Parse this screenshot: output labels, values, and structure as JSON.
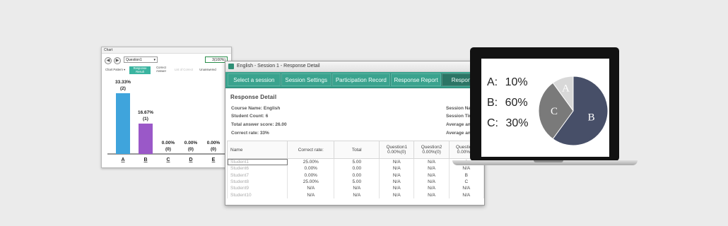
{
  "chart_window": {
    "title": "Chart",
    "nav_back": "◀",
    "nav_forward": "▶",
    "question_select": "Question1",
    "count_box": "3(100%)",
    "tabs": [
      {
        "label": "Chart Pattern ▾"
      },
      {
        "label": "Response Result",
        "active": true
      },
      {
        "label": "Correct Answer"
      },
      {
        "label": "List of Correct"
      },
      {
        "label": "Unanswered"
      }
    ]
  },
  "chart_data": {
    "type": "bar",
    "categories": [
      "A",
      "B",
      "C",
      "D",
      "E"
    ],
    "values": [
      33.33,
      16.67,
      0,
      0,
      0
    ],
    "value_labels": [
      "33.33%",
      "16.67%",
      "0.00%",
      "0.00%",
      "0.00%"
    ],
    "count_labels": [
      "(2)",
      "(1)",
      "(0)",
      "(0)",
      "(0)"
    ],
    "colors": [
      "#3fa4dc",
      "#9a58c8",
      "#999999",
      "#999999",
      "#999999"
    ],
    "ylim": [
      0,
      33.33
    ]
  },
  "detail_window": {
    "title": "English - Session 1 - Response Detail",
    "nav": [
      {
        "label": "Select a session"
      },
      {
        "label": "Session Settings"
      },
      {
        "label": "Participation Record"
      },
      {
        "label": "Response Report"
      },
      {
        "label": "Respons",
        "active": true
      }
    ],
    "heading": "Response Detail",
    "course": "Course Name: English",
    "student_count": "Student Count: 6",
    "total_score": "Total answer score: 26.00",
    "correct_rate": "Correct rate: 33%",
    "session_name": "Session Name",
    "session_time": "Session Time:",
    "avg_1": "Average answe",
    "avg_2": "Average answe",
    "columns": [
      "Name",
      "Correct rate:",
      "Total",
      "Question1\n0.00%(0)",
      "Question2\n0.00%(0)",
      "Question3\n0.00%(0)"
    ],
    "rows": [
      [
        "Student1",
        "25.00%",
        "5.00",
        "N/A",
        "N/A",
        "A"
      ],
      [
        "Student6",
        "0.00%",
        "0.00",
        "N/A",
        "N/A",
        "N/A"
      ],
      [
        "Student7",
        "0.00%",
        "0.00",
        "N/A",
        "N/A",
        "B"
      ],
      [
        "Student8",
        "25.00%",
        "5.00",
        "N/A",
        "N/A",
        "C"
      ],
      [
        "Student9",
        "N/A",
        "N/A",
        "N/A",
        "N/A",
        "N/A"
      ],
      [
        "Student10",
        "N/A",
        "N/A",
        "N/A",
        "N/A",
        "N/A"
      ]
    ]
  },
  "laptop": {
    "legend": [
      {
        "label": "A:",
        "value": "10%"
      },
      {
        "label": "B:",
        "value": "60%"
      },
      {
        "label": "C:",
        "value": "30%"
      }
    ],
    "pie_data": {
      "type": "pie",
      "slices": [
        {
          "label": "A",
          "value": 10,
          "color": "#d8d8d8"
        },
        {
          "label": "B",
          "value": 60,
          "color": "#474f68"
        },
        {
          "label": "C",
          "value": 30,
          "color": "#7a7a7a"
        }
      ]
    }
  }
}
